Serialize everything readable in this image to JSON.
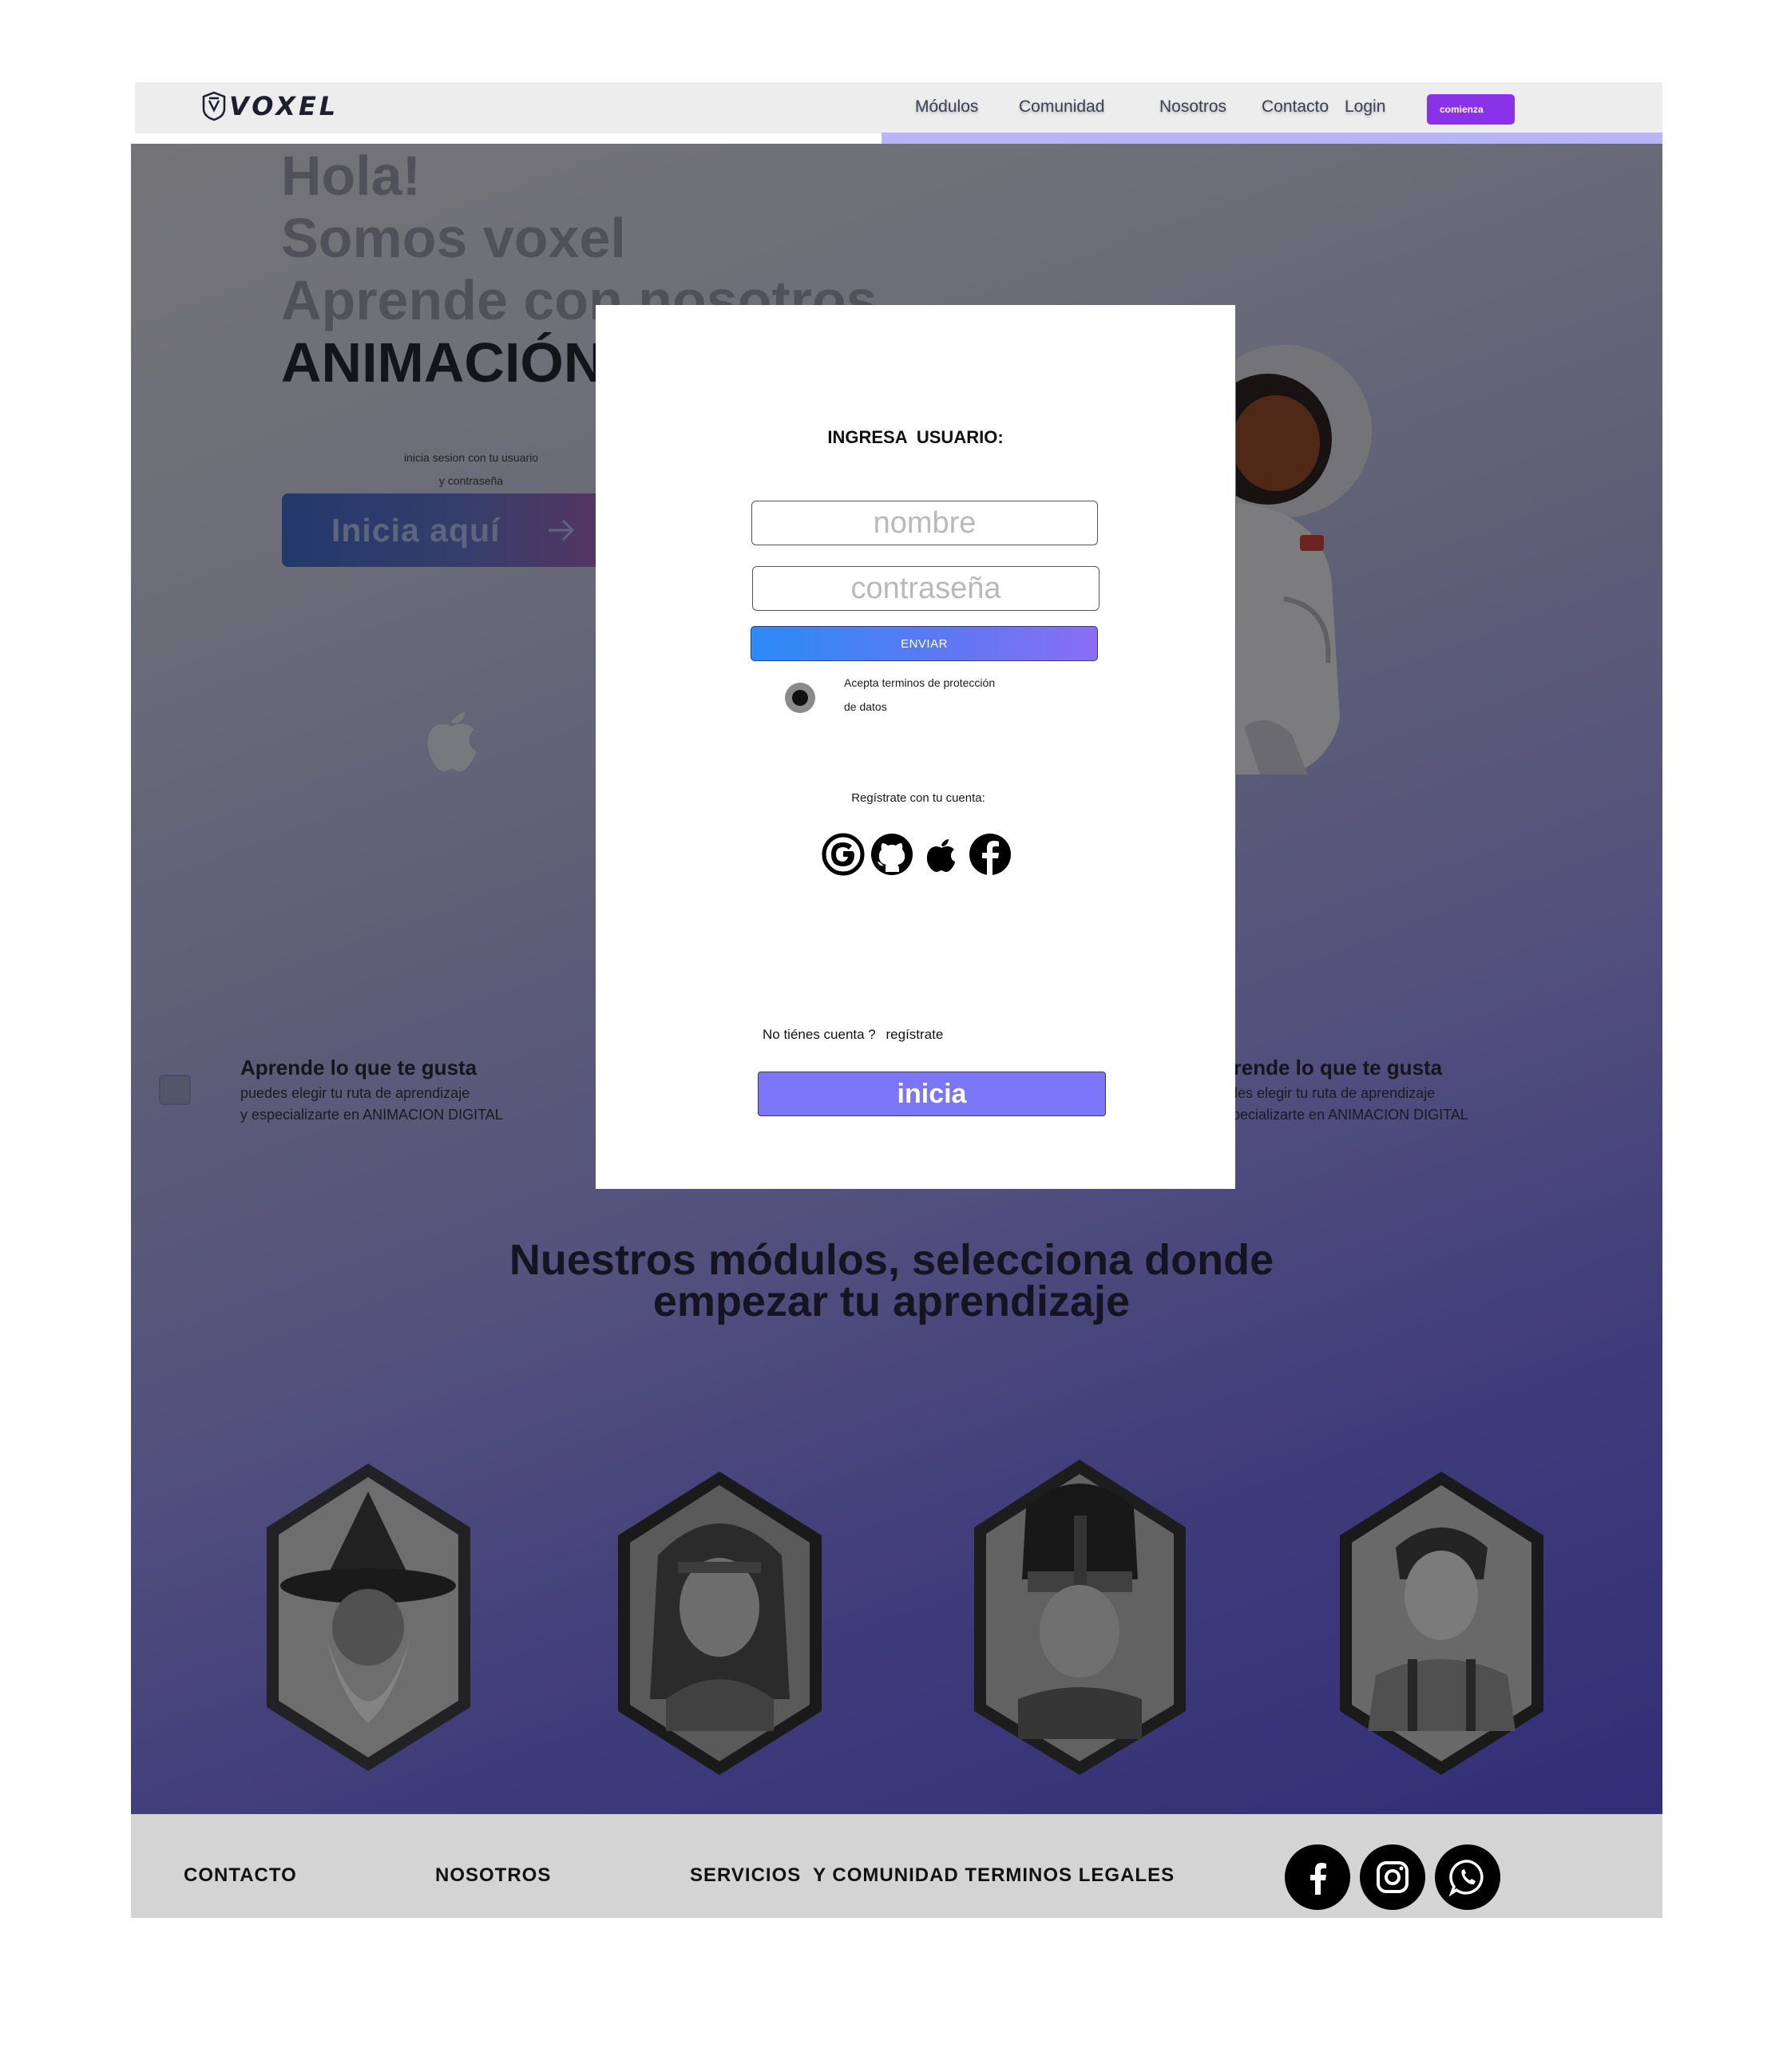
{
  "brand": {
    "name": "VOXEL"
  },
  "nav": {
    "links": [
      "Módulos",
      "Comunidad",
      "Nosotros",
      "Contacto",
      "Login"
    ],
    "cta": "comienza"
  },
  "hero": {
    "line1": "Hola!",
    "line2": "Somos voxel",
    "line3": "Aprende con nosotros",
    "line4": "ANIMACIÓN",
    "button": "Inicia aquí"
  },
  "features": [
    {
      "title": "Aprende lo que te gusta",
      "line1": "puedes elegir tu ruta de aprendizaje",
      "line2": "y especializarte en ANIMACION DIGITAL"
    },
    {
      "title": "Aprende lo que te gusta",
      "line1": "puedes elegir tu ruta de aprendizaje",
      "line2": "y especializarte en ANIMACION DIGITAL"
    }
  ],
  "modules_section": {
    "title_line1": "Nuestros módulos, selecciona donde",
    "title_line2": "empezar tu aprendizaje",
    "modules": [
      {
        "icon": "wizard-portrait"
      },
      {
        "icon": "warrior-woman-portrait"
      },
      {
        "icon": "helmeted-warrior-portrait"
      },
      {
        "icon": "young-explorer-portrait"
      }
    ]
  },
  "footer": {
    "links": [
      "CONTACTO",
      "NOSOTROS",
      "SERVICIOS  Y COMUNIDAD TERMINOS LEGALES"
    ],
    "social": [
      "facebook-icon",
      "instagram-icon",
      "whatsapp-icon"
    ]
  },
  "login_modal": {
    "title": "INGRESA  USUARIO:",
    "subtitle_line1": "inicia sesion con tu usuario",
    "subtitle_line2": "y contraseña",
    "username_placeholder": "nombre",
    "password_placeholder": "contraseña",
    "send_button": "ENVIAR",
    "terms_line1": "Acepta terminos de protección",
    "terms_line2": "de datos",
    "terms_selected": true,
    "register_with": "Regístrate con tu cuenta:",
    "providers": [
      "google-icon",
      "github-icon",
      "apple-icon",
      "facebook-icon"
    ],
    "no_account": "No tiénes cuenta ?",
    "register_link": "regístrate",
    "start_button": "inicia"
  },
  "colors": {
    "nav_bg": "#ededed",
    "cta": "#8a32ea",
    "send_gradient_start": "#2b8bf6",
    "send_gradient_end": "#8a6ef5",
    "start_button": "#7a76f7",
    "footer_bg": "#d4d4d4"
  }
}
